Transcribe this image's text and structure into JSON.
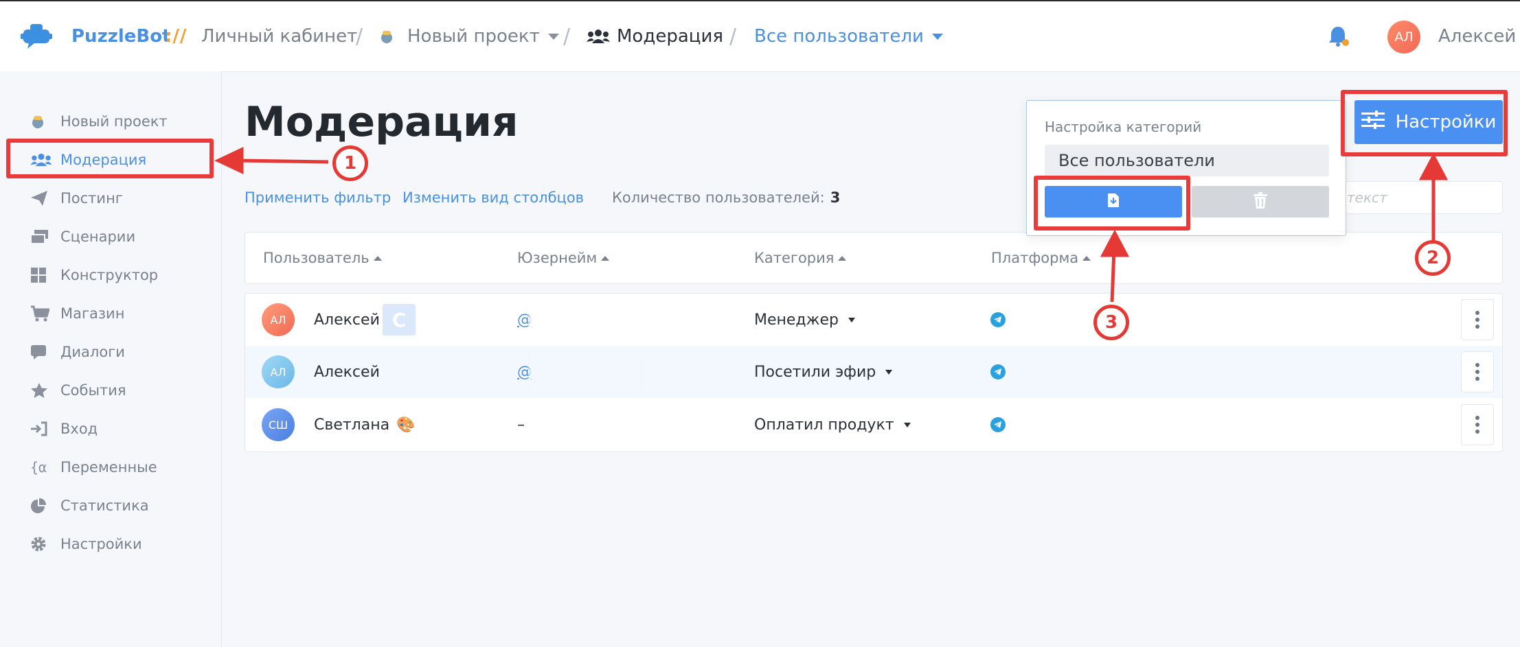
{
  "header": {
    "brand": "PuzzleBot",
    "brand_sep": "://",
    "breadcrumb": {
      "cabinet": "Личный кабинет",
      "project": "Новый проект",
      "moderation": "Модерация",
      "all_users": "Все пользователи"
    },
    "user_initials": "АЛ",
    "user_name": "Алексей"
  },
  "sidebar": {
    "items": [
      {
        "label": "Новый проект"
      },
      {
        "label": "Модерация"
      },
      {
        "label": "Постинг"
      },
      {
        "label": "Сценарии"
      },
      {
        "label": "Конструктор"
      },
      {
        "label": "Магазин"
      },
      {
        "label": "Диалоги"
      },
      {
        "label": "События"
      },
      {
        "label": "Вход"
      },
      {
        "label": "Переменные"
      },
      {
        "label": "Статистика"
      },
      {
        "label": "Настройки"
      }
    ]
  },
  "main": {
    "title": "Модерация",
    "apply_filter": "Применить фильтр",
    "change_columns": "Изменить вид столбцов",
    "count_label": "Количество пользователей:",
    "count_value": "3",
    "search_placeholder": "текст",
    "columns": [
      "Пользователь",
      "Юзернейм",
      "Категория",
      "Платформа"
    ],
    "rows": [
      {
        "initials": "АЛ",
        "name": "Алексей",
        "badge": "С",
        "username": "@",
        "category": "Менеджер"
      },
      {
        "initials": "АЛ",
        "name": "Алексей",
        "username": "@",
        "category": "Посетили эфир"
      },
      {
        "initials": "СШ",
        "name": "Светлана",
        "emoji": "🎨",
        "username": "–",
        "category": "Оплатил продукт"
      }
    ]
  },
  "settings_button": "Настройки",
  "popover": {
    "label": "Настройка категорий",
    "selected": "Все пользователи"
  },
  "annotations": {
    "n1": "1",
    "n2": "2",
    "n3": "3"
  }
}
